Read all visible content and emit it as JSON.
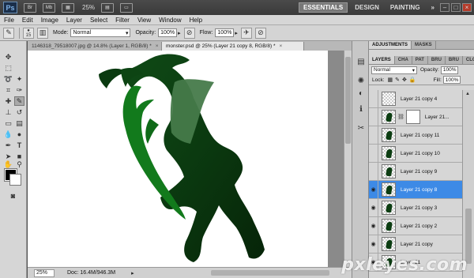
{
  "app": {
    "logo": "Ps",
    "zoom": "25%",
    "workspaces": [
      "ESSENTIALS",
      "DESIGN",
      "PAINTING"
    ],
    "more": "»",
    "icons": [
      "br-icon",
      "mb-icon"
    ]
  },
  "menu": [
    "File",
    "Edit",
    "Image",
    "Layer",
    "Select",
    "Filter",
    "View",
    "Window",
    "Help"
  ],
  "options": {
    "brush_size": "15",
    "mode_label": "Mode:",
    "mode_value": "Normal",
    "opacity_label": "Opacity:",
    "opacity_value": "100%",
    "flow_label": "Flow:",
    "flow_value": "100%"
  },
  "doc_tabs": [
    {
      "label": "1146318_79518007.jpg @ 14.8% (Layer 1, RGB/8) *",
      "active": false
    },
    {
      "label": "monster.psd @ 25% (Layer 21 copy 8, RGB/8) *",
      "active": true
    }
  ],
  "status": {
    "zoom": "25%",
    "doc_info": "Doc: 16.4M/946.3M"
  },
  "panels": {
    "top_tabs": [
      "ADJUSTMENTS",
      "MASKS"
    ],
    "layer_tabs": [
      "LAYERS",
      "CHA",
      "PAT",
      "BRU",
      "BRU",
      "CLO"
    ],
    "blend_mode": "Normal",
    "opacity_label": "Opacity:",
    "opacity_value": "100%",
    "lock_label": "Lock:",
    "fill_label": "Fill:",
    "fill_value": "100%"
  },
  "layers": [
    {
      "name": "Layer 21 copy 4",
      "visible": false,
      "selected": false,
      "mask": false
    },
    {
      "name": "Layer 21...",
      "visible": false,
      "selected": false,
      "mask": true
    },
    {
      "name": "Layer 21 copy 11",
      "visible": false,
      "selected": false,
      "mask": false
    },
    {
      "name": "Layer 21 copy 10",
      "visible": false,
      "selected": false,
      "mask": false
    },
    {
      "name": "Layer 21 copy 9",
      "visible": false,
      "selected": false,
      "mask": false
    },
    {
      "name": "Layer 21 copy 8",
      "visible": true,
      "selected": true,
      "mask": false
    },
    {
      "name": "Layer 21 copy 3",
      "visible": true,
      "selected": false,
      "mask": false
    },
    {
      "name": "Layer 21 copy 2",
      "visible": true,
      "selected": false,
      "mask": false
    },
    {
      "name": "Layer 21 copy",
      "visible": true,
      "selected": false,
      "mask": false
    },
    {
      "name": "Layer 21",
      "visible": true,
      "selected": false,
      "mask": false
    }
  ],
  "watermark": "pxleyes.com"
}
